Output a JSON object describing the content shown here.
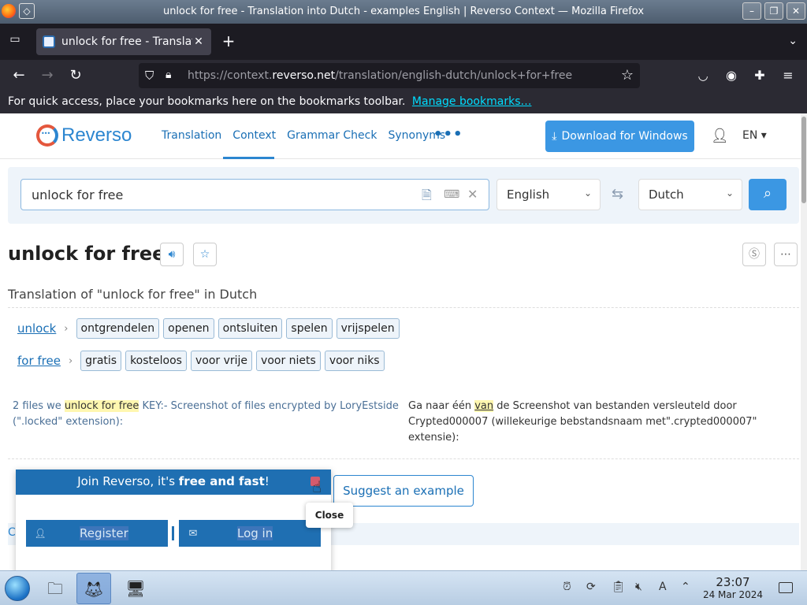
{
  "window": {
    "title": "unlock for free - Translation into Dutch - examples English | Reverso Context — Mozilla Firefox",
    "minimize": "–",
    "maximize": "❐",
    "close": "✕"
  },
  "browser": {
    "tab_label": "unlock for free - Translati",
    "tab_close": "✕",
    "new_tab": "+",
    "url_prefix": "https://context.",
    "url_domain": "reverso.net",
    "url_path": "/translation/english-dutch/unlock+for+free",
    "bookmarks_text": "For quick access, place your bookmarks here on the bookmarks toolbar.",
    "bookmarks_link": "Manage bookmarks…"
  },
  "site": {
    "logo_text": "Reverso",
    "nav": [
      "Translation",
      "Context",
      "Grammar Check",
      "Synonyms"
    ],
    "nav_more": "•••",
    "download_label": "Download for Windows",
    "lang": "EN ▾",
    "brand_color": "#2c86d0"
  },
  "search": {
    "query": "unlock for free",
    "source_lang": "English",
    "target_lang": "Dutch"
  },
  "result": {
    "title": "unlock for free",
    "subtitle": "Translation of \"unlock for free\" in Dutch",
    "rows": [
      {
        "source": "unlock",
        "translations": [
          "ontgrendelen",
          "openen",
          "ontsluiten",
          "spelen",
          "vrijspelen"
        ]
      },
      {
        "source": "for free",
        "translations": [
          "gratis",
          "kosteloos",
          "voor vrije",
          "voor niets",
          "voor niks"
        ]
      }
    ],
    "example": {
      "src_before": "2 files we ",
      "src_highlight": "unlock for free",
      "src_after": " KEY:- Screenshot of files encrypted by LoryEstside (\".locked\" extension):",
      "tgt_before": "Ga naar één ",
      "tgt_highlight": "van",
      "tgt_after": " de Screenshot van bestanden versleuteld door Crypted000007 (willekeurige bebstandsnaam met\".crypted000007\" extensie):"
    },
    "suggest_label": "Suggest an example"
  },
  "popup": {
    "head_before": "Join Reverso, it's ",
    "head_bold": "free and fast",
    "head_after": "!",
    "register_label": "Register",
    "login_label": "Log in",
    "tooltip": "Close"
  },
  "taskbar": {
    "time": "23:07",
    "date": "24 Mar 2024"
  }
}
